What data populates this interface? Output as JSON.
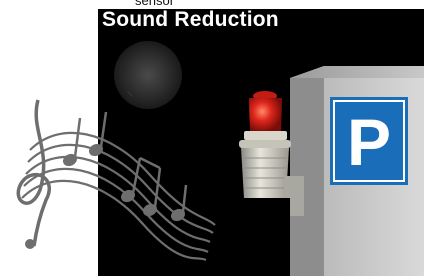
{
  "top_caption": "sensor",
  "title": "Sound Reduction",
  "parking_sign": {
    "letter": "P",
    "color": "#1a6db8"
  },
  "colors": {
    "background": "#000000",
    "moon": "#f4d31a",
    "beacon": "#e0271d",
    "notes": "#6e6e6e"
  },
  "icons": [
    "moon-icon",
    "music-notes-icon",
    "warning-beacon-icon",
    "parking-sign-icon"
  ]
}
